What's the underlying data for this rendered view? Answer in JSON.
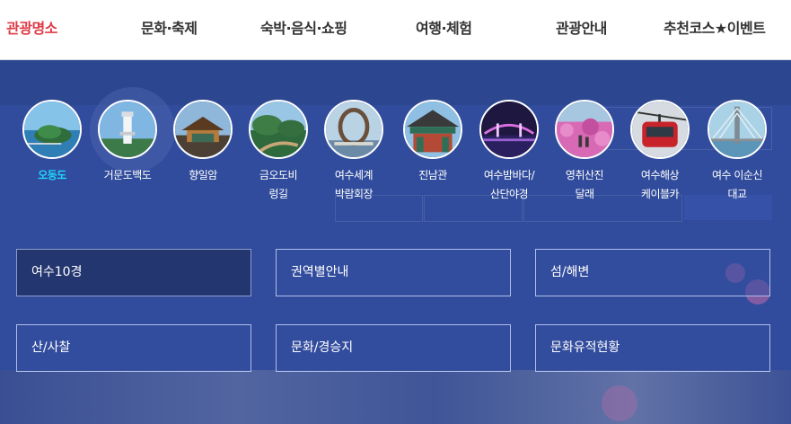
{
  "topnav": {
    "items": [
      {
        "label": "관광명소",
        "active": true
      },
      {
        "label": "문화·축제",
        "active": false
      },
      {
        "label": "숙박·음식·쇼핑",
        "active": false
      },
      {
        "label": "여행·체험",
        "active": false
      },
      {
        "label": "관광안내",
        "active": false
      },
      {
        "label": "추천코스★이벤트",
        "active": false
      }
    ],
    "active_color": "#e03a45"
  },
  "attractions": [
    {
      "label": "오동도",
      "icon": "odongdo-island-thumbnail",
      "active": true
    },
    {
      "label": "거문도백도",
      "icon": "lighthouse-thumbnail",
      "active": false
    },
    {
      "label": "향일암",
      "icon": "temple-thumbnail",
      "active": false
    },
    {
      "label": "금오도비\n렁길",
      "icon": "coastal-trail-thumbnail",
      "active": false
    },
    {
      "label": "여수세계\n박람회장",
      "icon": "expo-ring-thumbnail",
      "active": false
    },
    {
      "label": "진남관",
      "icon": "pavilion-thumbnail",
      "active": false
    },
    {
      "label": "여수밤바다/\n산단야경",
      "icon": "night-sea-thumbnail",
      "active": false
    },
    {
      "label": "영취산진\n달래",
      "icon": "azalea-mountain-thumbnail",
      "active": false
    },
    {
      "label": "여수해상\n케이블카",
      "icon": "cable-car-thumbnail",
      "active": false
    },
    {
      "label": "여수 이순신\n대교",
      "icon": "bridge-thumbnail",
      "active": false
    }
  ],
  "categories": [
    {
      "label": "여수10경",
      "active": true
    },
    {
      "label": "권역별안내",
      "active": false
    },
    {
      "label": "섬/해변",
      "active": false
    },
    {
      "label": "산/사찰",
      "active": false
    },
    {
      "label": "문화/경승지",
      "active": false
    },
    {
      "label": "문화유적현황",
      "active": false
    }
  ],
  "colors": {
    "overlay": "#2f4a9a",
    "active_thumb_label": "#1fd5ff",
    "active_category_bg": "#24366f"
  }
}
